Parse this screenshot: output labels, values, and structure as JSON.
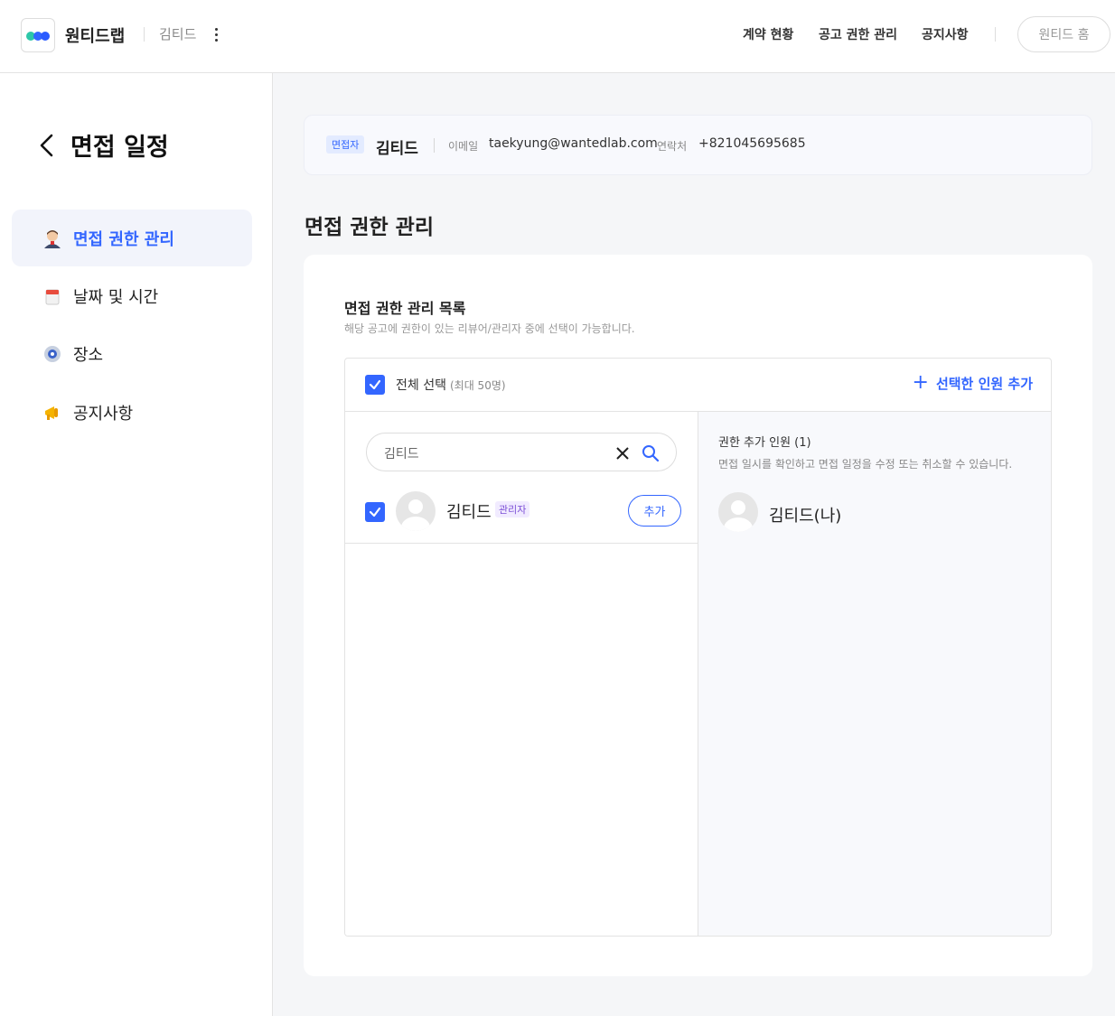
{
  "header": {
    "company": "원티드랩",
    "user": "김티드",
    "nav": [
      "계약 현황",
      "공고 권한 관리",
      "공지사항"
    ],
    "home_button": "원티드 홈"
  },
  "sidebar": {
    "title": "면접 일정",
    "items": [
      {
        "label": "면접 권한 관리",
        "icon": "interviewer-icon",
        "active": true
      },
      {
        "label": "날짜 및 시간",
        "icon": "calendar-icon",
        "active": false
      },
      {
        "label": "장소",
        "icon": "location-icon",
        "active": false
      },
      {
        "label": "공지사항",
        "icon": "megaphone-icon",
        "active": false
      }
    ]
  },
  "candidate": {
    "badge": "면접자",
    "name": "김티드",
    "email_label": "이메일",
    "email": "taekyung@wantedlab.com",
    "phone_label": "연락처",
    "phone": "+821045695685"
  },
  "main": {
    "section_title": "면접 권한 관리",
    "list_title": "면접 권한 관리 목록",
    "list_desc": "해당 공고에 권한이 있는 리뷰어/관리자 중에 선택이 가능합니다.",
    "select_all": "전체 선택",
    "select_all_sub": "(최대 50명)",
    "add_selected": "선택한 인원 추가",
    "search_value": "김티드",
    "members": [
      {
        "name": "김티드",
        "role": "관리자",
        "add_label": "추가",
        "checked": true
      }
    ],
    "added_title": "권한 추가 인원 (1)",
    "added_desc": "면접 일시를 확인하고 면접 일정을 수정 또는 취소할 수 있습니다.",
    "added_members": [
      "김티드(나)"
    ]
  },
  "colors": {
    "accent": "#3366ff",
    "role_badge": "#7b4fd6"
  }
}
